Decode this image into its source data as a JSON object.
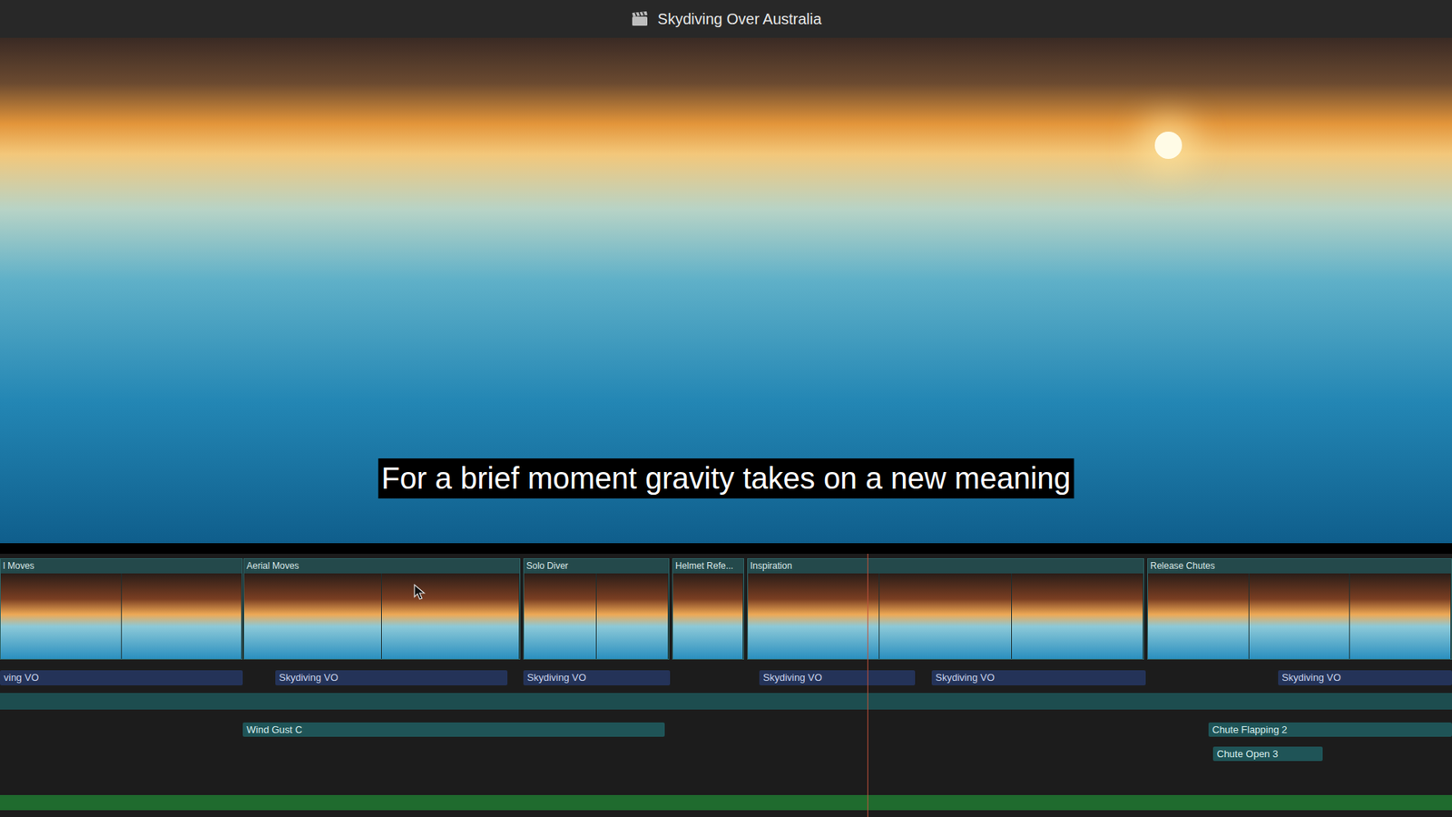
{
  "window": {
    "title": "Skydiving Over Australia"
  },
  "viewer": {
    "caption": "For a brief moment gravity takes on a new meaning"
  },
  "timeline": {
    "clips": [
      {
        "name": "l Moves"
      },
      {
        "name": "Aerial Moves"
      },
      {
        "name": "Solo Diver"
      },
      {
        "name": "Helmet Refe..."
      },
      {
        "name": "Inspiration"
      },
      {
        "name": "Release Chutes"
      }
    ],
    "audio_clips": [
      {
        "name": "ving VO",
        "kind": "voiceover"
      },
      {
        "name": "Skydiving VO",
        "kind": "voiceover"
      },
      {
        "name": "Skydiving VO",
        "kind": "voiceover"
      },
      {
        "name": "Skydiving VO",
        "kind": "voiceover"
      },
      {
        "name": "Skydiving VO",
        "kind": "voiceover"
      },
      {
        "name": "Skydiving VO",
        "kind": "voiceover"
      },
      {
        "name": "Wind Gust C",
        "kind": "effect"
      },
      {
        "name": "Chute Flapping 2",
        "kind": "effect"
      },
      {
        "name": "Chute Open 3",
        "kind": "effect"
      }
    ]
  }
}
